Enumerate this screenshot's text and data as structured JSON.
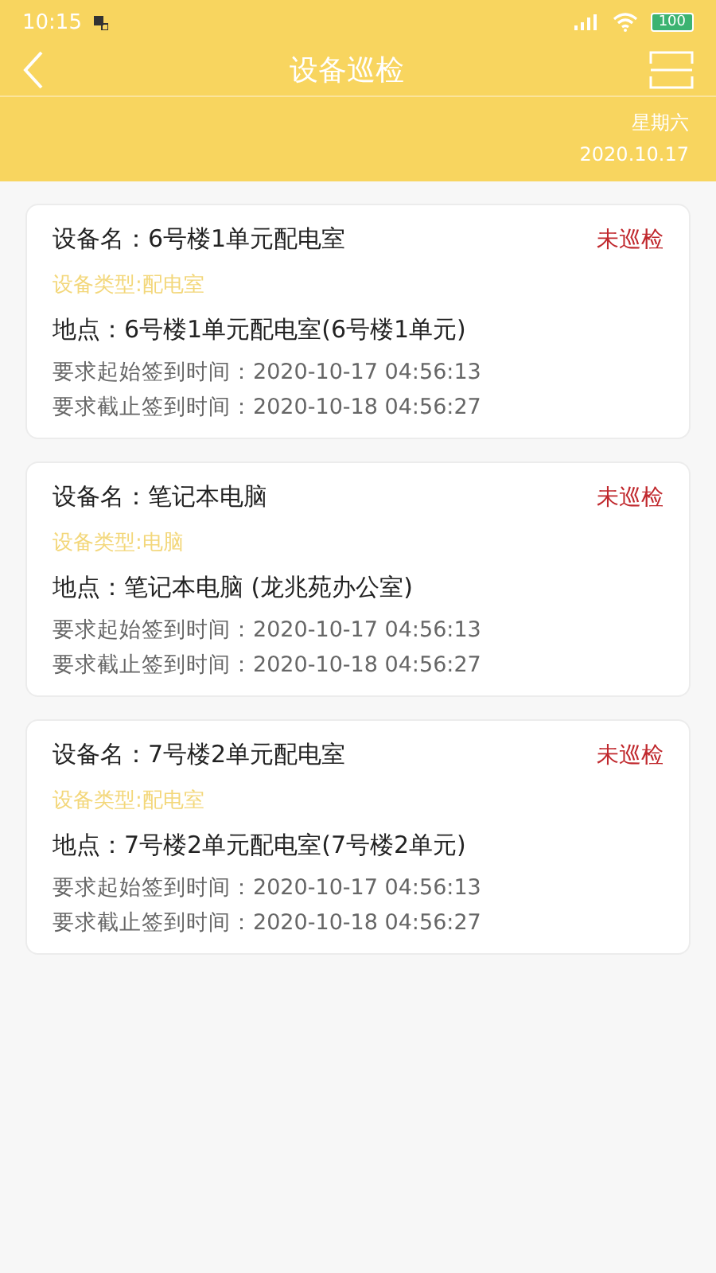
{
  "status_bar": {
    "time": "10:15",
    "battery": "100"
  },
  "header": {
    "title": "设备巡检",
    "weekday": "星期六",
    "date": "2020.10.17"
  },
  "cards": [
    {
      "name": "设备名：6号楼1单元配电室",
      "status": "未巡检",
      "type": "设备类型:配电室",
      "location": "地点：6号楼1单元配电室(6号楼1单元)",
      "start": "要求起始签到时间：2020-10-17 04:56:13",
      "end": "要求截止签到时间：2020-10-18 04:56:27"
    },
    {
      "name": "设备名：笔记本电脑",
      "status": "未巡检",
      "type": "设备类型:电脑",
      "location": "地点：笔记本电脑 (龙兆苑办公室)",
      "start": "要求起始签到时间：2020-10-17 04:56:13",
      "end": "要求截止签到时间：2020-10-18 04:56:27"
    },
    {
      "name": "设备名：7号楼2单元配电室",
      "status": "未巡检",
      "type": "设备类型:配电室",
      "location": "地点：7号楼2单元配电室(7号楼2单元)",
      "start": "要求起始签到时间：2020-10-17 04:56:13",
      "end": "要求截止签到时间：2020-10-18 04:56:27"
    }
  ]
}
